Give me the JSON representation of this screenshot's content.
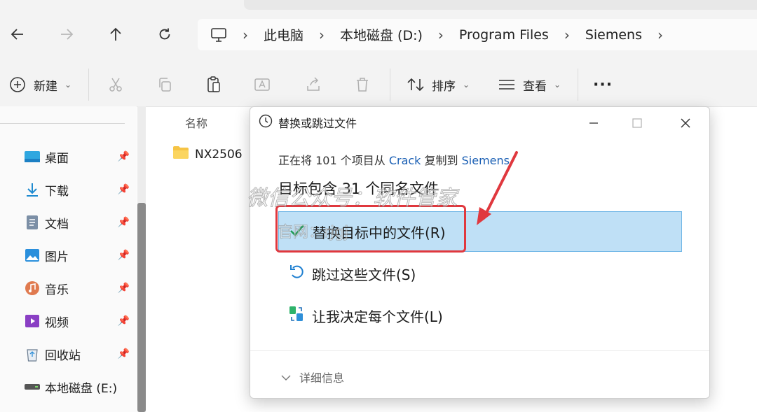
{
  "nav": {
    "back_icon": "arrow-left-icon",
    "forward_icon": "arrow-right-icon",
    "up_icon": "arrow-up-icon",
    "refresh_icon": "refresh-icon"
  },
  "address": {
    "root_icon": "computer-icon",
    "segments": [
      "此电脑",
      "本地磁盘 (D:)",
      "Program Files",
      "Siemens"
    ]
  },
  "toolbar": {
    "new_label": "新建",
    "sort_label": "排序",
    "view_label": "查看",
    "more_label": "···"
  },
  "sidebar": {
    "items": [
      {
        "label": "桌面",
        "icon": "desktop-icon"
      },
      {
        "label": "下载",
        "icon": "download-icon"
      },
      {
        "label": "文档",
        "icon": "document-icon"
      },
      {
        "label": "图片",
        "icon": "pictures-icon"
      },
      {
        "label": "音乐",
        "icon": "music-icon"
      },
      {
        "label": "视频",
        "icon": "video-icon"
      },
      {
        "label": "回收站",
        "icon": "recycle-bin-icon"
      },
      {
        "label": "本地磁盘 (E:)",
        "icon": "drive-icon"
      }
    ]
  },
  "files": {
    "column_name": "名称",
    "rows": [
      {
        "name": "NX2506"
      }
    ]
  },
  "dialog": {
    "title": "替换或跳过文件",
    "msg_prefix": "正在将 101 个项目从 ",
    "msg_source": "Crack",
    "msg_middle": " 复制到 ",
    "msg_dest": "Siemens",
    "heading": "目标包含 31 个同名文件",
    "options": [
      {
        "label": "替换目标中的文件(R)",
        "icon": "checkmark-icon"
      },
      {
        "label": "跳过这些文件(S)",
        "icon": "skip-arrow-icon"
      },
      {
        "label": "让我决定每个文件(L)",
        "icon": "decide-icon"
      }
    ],
    "details_label": "详细信息"
  },
  "watermark": {
    "line1": "微信公众号：软件管家",
    "line2": "官网：rjgj"
  },
  "colors": {
    "accent": "#1a5fb4",
    "selected_bg": "#bfe0f6",
    "highlight_red": "#e0383e"
  }
}
